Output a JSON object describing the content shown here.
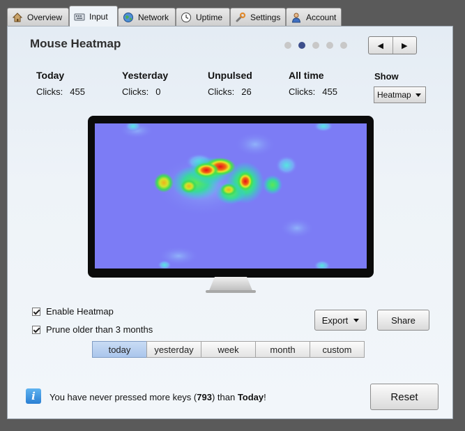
{
  "tabs": [
    {
      "label": "Overview",
      "icon": "home-icon"
    },
    {
      "label": "Input",
      "icon": "keyboard-icon",
      "active": true
    },
    {
      "label": "Network",
      "icon": "globe-icon"
    },
    {
      "label": "Uptime",
      "icon": "clock-icon"
    },
    {
      "label": "Settings",
      "icon": "wrench-icon"
    },
    {
      "label": "Account",
      "icon": "user-icon"
    }
  ],
  "header": {
    "title": "Mouse Heatmap",
    "page_count": 5,
    "current_page": 2
  },
  "pager": {
    "prev": "◀",
    "next": "▶"
  },
  "stats": [
    {
      "heading": "Today",
      "label": "Clicks:",
      "value": "455"
    },
    {
      "heading": "Yesterday",
      "label": "Clicks:",
      "value": "0"
    },
    {
      "heading": "Unpulsed",
      "label": "Clicks:",
      "value": "26"
    },
    {
      "heading": "All time",
      "label": "Clicks:",
      "value": "455"
    }
  ],
  "show": {
    "label": "Show",
    "selected": "Heatmap"
  },
  "options": {
    "enable_heatmap": {
      "label": "Enable Heatmap",
      "checked": true
    },
    "prune": {
      "label": "Prune older than 3 months",
      "checked": true
    }
  },
  "buttons": {
    "export": "Export",
    "share": "Share",
    "reset": "Reset"
  },
  "ranges": [
    {
      "label": "today",
      "selected": true
    },
    {
      "label": "yesterday"
    },
    {
      "label": "week"
    },
    {
      "label": "month"
    },
    {
      "label": "custom"
    }
  ],
  "message": {
    "before": "You have never pressed more keys (",
    "count": "793",
    "middle": ") than ",
    "day": "Today",
    "after": "!"
  },
  "colors": {
    "heatmap_background": "#7c7cf5",
    "selected_range": "#aac6ec",
    "info_icon": "#2a7fd3"
  }
}
